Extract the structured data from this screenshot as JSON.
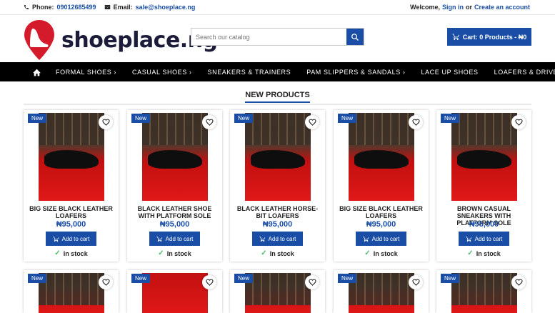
{
  "topbar": {
    "phone_label": "Phone:",
    "phone": "09012685499",
    "email_label": "Email:",
    "email": "sale@shoeplace.ng",
    "welcome": "Welcome,",
    "sign_in": "Sign in",
    "or": "or",
    "create_account": "Create an account"
  },
  "header": {
    "logo_text": "shoeplace.ng",
    "search_placeholder": "Search our catalog",
    "cart_label": "Cart: 0 Products - ₦0"
  },
  "nav": {
    "items": [
      {
        "label": "FORMAL SHOES",
        "dropdown": true
      },
      {
        "label": "CASUAL SHOES",
        "dropdown": true
      },
      {
        "label": "SNEAKERS & TRAINERS",
        "dropdown": false
      },
      {
        "label": "PAM SLIPPERS & SANDALS",
        "dropdown": true
      },
      {
        "label": "LACE UP SHOES",
        "dropdown": false
      },
      {
        "label": "LOAFERS & DRIVERS",
        "dropdown": false
      }
    ]
  },
  "section_title": "NEW PRODUCTS",
  "products": [
    {
      "badge": "New",
      "name": "BIG SIZE BLACK LEATHER LOAFERS",
      "price": "₦95,000",
      "add_label": "Add to cart",
      "stock": "In stock"
    },
    {
      "badge": "New",
      "name": "BLACK LEATHER SHOE WITH PLATFORM SOLE",
      "price": "₦95,000",
      "add_label": "Add to cart",
      "stock": "In stock"
    },
    {
      "badge": "New",
      "name": "BLACK LEATHER HORSE-BIT LOAFERS",
      "price": "₦95,000",
      "add_label": "Add to cart",
      "stock": "In stock"
    },
    {
      "badge": "New",
      "name": "BIG SIZE BLACK LEATHER LOAFERS",
      "price": "₦95,000",
      "add_label": "Add to cart",
      "stock": "In stock"
    },
    {
      "badge": "New",
      "name": "BROWN CASUAL SNEAKERS WITH PLATFORM SOLE",
      "price": "₦95,000",
      "add_label": "Add to cart",
      "stock": "In stock"
    }
  ],
  "second_row_badges": [
    "New",
    "New",
    "New",
    "New",
    "New"
  ],
  "colors": {
    "accent": "#1a4ea6",
    "nav_bg": "#000000",
    "stock_tick": "#4cbb6c"
  }
}
